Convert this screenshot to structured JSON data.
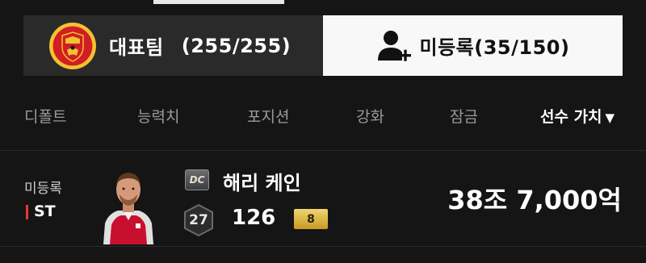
{
  "tabs": {
    "team": {
      "label": "대표팀",
      "count": "(255/255)"
    },
    "unregistered": {
      "label": "미등록(35/150)"
    }
  },
  "filters": {
    "default": "디폴트",
    "ability": "능력치",
    "position": "포지션",
    "enhance": "강화",
    "lock": "잠금",
    "player_value": "선수 가치",
    "sort_caret": "▼"
  },
  "player": {
    "status": "미등록",
    "position": "ST",
    "season_badge": "DC",
    "name": "해리 케인",
    "ovr_grade": "27",
    "rating": "126",
    "upgrade_level": "8",
    "value": "38조 7,000억"
  },
  "colors": {
    "background": "#151515",
    "position_bar": "#e53935",
    "upgrade_gold": "#d8ae3c",
    "active_tab": "#f8f8f8"
  },
  "icons": {
    "team_crest": "manchester-united-crest-icon",
    "add_person": "add-person-icon",
    "sort": "caret-down-icon"
  }
}
